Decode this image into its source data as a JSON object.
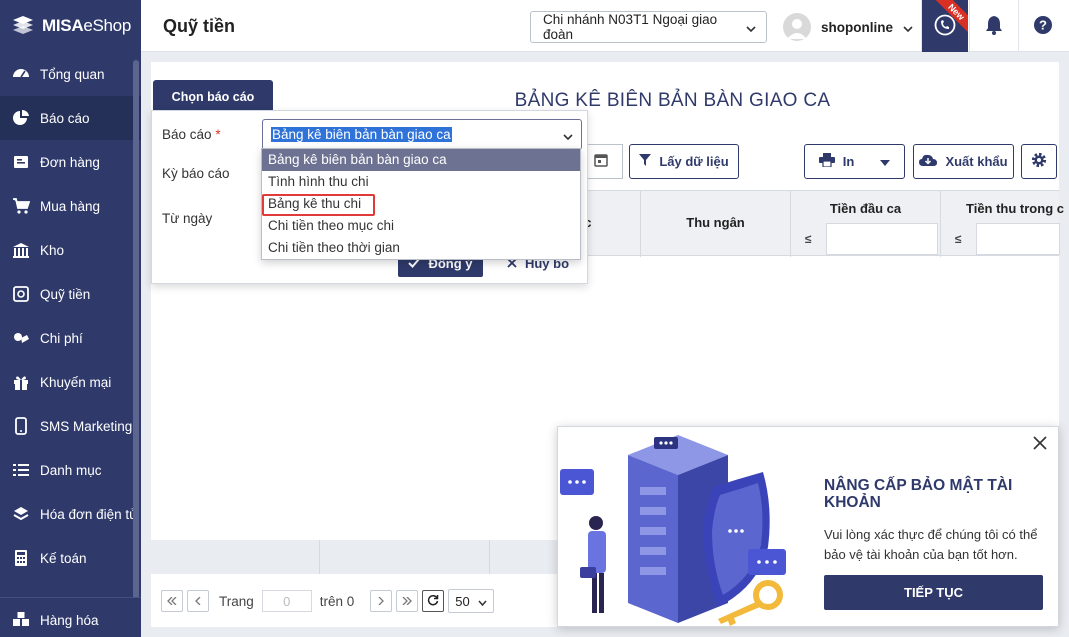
{
  "app": {
    "logo_text_bold": "MISA",
    "logo_text_normal": "eShop"
  },
  "sidebar": {
    "items": [
      {
        "label": "Tổng quan",
        "icon": "dashboard-icon"
      },
      {
        "label": "Báo cáo",
        "icon": "pie-chart-icon",
        "active": true
      },
      {
        "label": "Đơn hàng",
        "icon": "order-icon"
      },
      {
        "label": "Mua hàng",
        "icon": "cart-icon"
      },
      {
        "label": "Kho",
        "icon": "warehouse-icon"
      },
      {
        "label": "Quỹ tiền",
        "icon": "safe-icon"
      },
      {
        "label": "Chi phí",
        "icon": "expense-icon"
      },
      {
        "label": "Khuyến mại",
        "icon": "gift-icon"
      },
      {
        "label": "SMS Marketing",
        "icon": "phone-icon"
      },
      {
        "label": "Danh mục",
        "icon": "list-icon"
      },
      {
        "label": "Hóa đơn điện tử",
        "icon": "invoice-icon"
      },
      {
        "label": "Kế toán",
        "icon": "calculator-icon"
      }
    ],
    "bottom_item": {
      "label": "Hàng hóa",
      "icon": "boxes-icon"
    }
  },
  "header": {
    "title": "Quỹ tiền",
    "branch": "Chi nhánh N03T1 Ngoại giao đoàn",
    "username": "shoponline",
    "new_badge": "New"
  },
  "report": {
    "title": "BẢNG KÊ BIÊN BẢN BÀN GIAO CA",
    "buttons": {
      "fetch": "Lấy dữ liệu",
      "print": "In",
      "export": "Xuất khẩu"
    },
    "columns": {
      "work": "ệc",
      "cashier": "Thu ngân",
      "opening": "Tiền đầu ca",
      "collected": "Tiền thu trong c"
    },
    "filter_op": "≤"
  },
  "chooser": {
    "tab_label": "Chọn báo cáo",
    "report_label": "Báo cáo",
    "required_mark": "*",
    "period_label": "Kỳ báo cáo",
    "from_label": "Từ ngày",
    "selected_report": "Bảng kê biên bản bàn giao ca",
    "confirm": "Đồng ý",
    "cancel": "Hủy bỏ",
    "options": [
      "Bảng kê biên bản bàn giao ca",
      "Tình hình thu chi",
      "Bảng kê thu chi",
      "Chi tiền theo mục chi",
      "Chi tiền theo thời gian"
    ]
  },
  "pager": {
    "page_label": "Trang",
    "page_value": "0",
    "of_label": "trên 0",
    "page_size": "50"
  },
  "promo": {
    "title": "NÂNG CẤP BẢO MẬT TÀI KHOẢN",
    "text": "Vui lòng xác thực để chúng tôi có thể bảo vệ tài khoản của bạn tốt hơn.",
    "button": "TIẾP TỤC"
  },
  "colors": {
    "brand": "#2f3a6b",
    "highlight": "#e03a3a",
    "selection": "#2f72d8"
  }
}
